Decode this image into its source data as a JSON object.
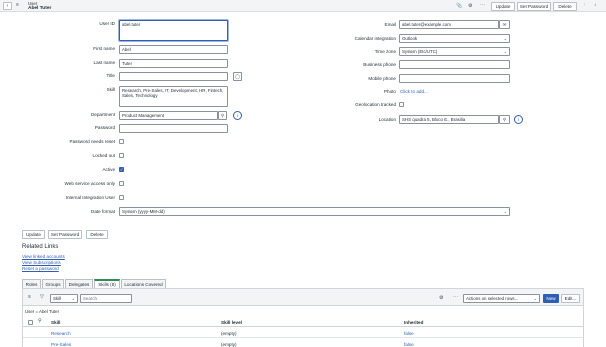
{
  "header": {
    "record_type": "User",
    "record_name": "Abel Tuter",
    "buttons": {
      "update": "Update",
      "set_password": "Set Password",
      "delete": "Delete"
    }
  },
  "form": {
    "user_id": {
      "label": "User ID",
      "value": "abel.tuter"
    },
    "first_name": {
      "label": "First name",
      "value": "Abel"
    },
    "last_name": {
      "label": "Last name",
      "value": "Tuter"
    },
    "title": {
      "label": "Title",
      "value": ""
    },
    "skill": {
      "label": "Skill",
      "value": "Research, Pre-Sales, IT, Development, HR, Fintech, Sales, Technology"
    },
    "department": {
      "label": "Department",
      "value": "Product Management"
    },
    "password": {
      "label": "Password",
      "value": ""
    },
    "password_needs_reset": {
      "label": "Password needs reset",
      "checked": false
    },
    "locked_out": {
      "label": "Locked out",
      "checked": false
    },
    "active": {
      "label": "Active",
      "checked": true
    },
    "web_service_only": {
      "label": "Web service access only",
      "checked": false
    },
    "internal_integration": {
      "label": "Internal Integration User",
      "checked": false
    },
    "date_format": {
      "label": "Date format",
      "value": "System (yyyy-MM-dd)"
    },
    "email": {
      "label": "Email",
      "value": "abel.tuter@example.com"
    },
    "calendar_integration": {
      "label": "Calendar integration",
      "value": "Outlook"
    },
    "time_zone": {
      "label": "Time zone",
      "value": "System (Etc/UTC)"
    },
    "business_phone": {
      "label": "Business phone",
      "value": ""
    },
    "mobile_phone": {
      "label": "Mobile phone",
      "value": ""
    },
    "photo": {
      "label": "Photo",
      "link": "Click to add..."
    },
    "geolocation_tracked": {
      "label": "Geolocation tracked",
      "checked": false
    },
    "location": {
      "label": "Location",
      "value": "SHS quadra 5, Bloco E., Brasilia"
    }
  },
  "bottom_buttons": {
    "update": "Update",
    "set_password": "Set Password",
    "delete": "Delete"
  },
  "related_links": {
    "title": "Related Links",
    "links": [
      "View linked accounts",
      "View Subscriptions",
      "Reset a password"
    ]
  },
  "tabs": [
    "Roles",
    "Groups",
    "Delegates",
    "Skills (8)",
    "Locations Covered"
  ],
  "list": {
    "search_field": "Skill",
    "search_placeholder": "Search",
    "actions_select": "Actions on selected rows...",
    "new_label": "New",
    "edit_label": "Edit...",
    "breadcrumb": "User = Abel Tuter",
    "columns": [
      "Skill",
      "Skill level",
      "Inherited"
    ],
    "rows": [
      {
        "skill": "Research",
        "level": "(empty)",
        "inherited": "false"
      },
      {
        "skill": "Pre-Sales",
        "level": "(empty)",
        "inherited": "false"
      }
    ]
  },
  "colors": {
    "primary": "#2f5fb3",
    "active_tab": "#2e8b57",
    "link": "#2f5fb3"
  },
  "icons": [
    "back-icon",
    "hamburger-icon",
    "attachment-icon",
    "activity-icon",
    "more-icon",
    "arrow-up-icon",
    "arrow-down-icon",
    "info-icon",
    "search-icon",
    "email-icon",
    "chevron-down-icon",
    "gear-icon",
    "filter-icon"
  ]
}
